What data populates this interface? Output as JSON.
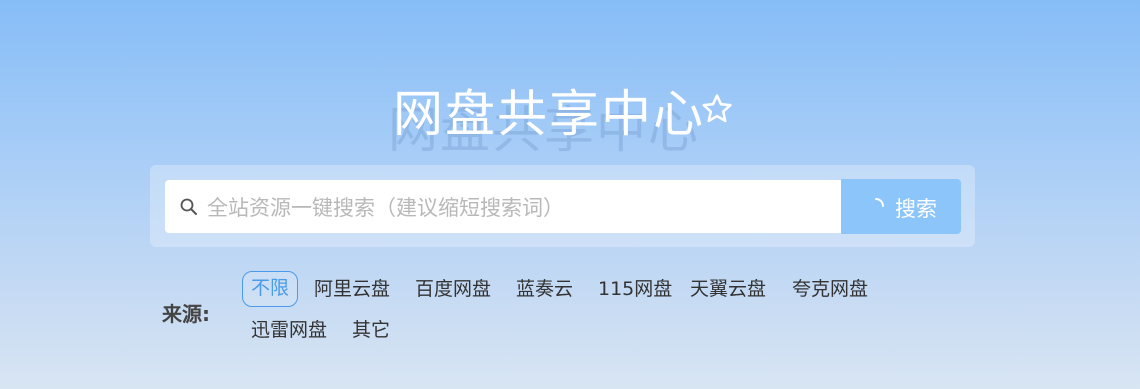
{
  "header": {
    "title": "网盘共享中心",
    "favorite_icon": "star-outline-icon"
  },
  "search": {
    "placeholder": "全站资源一键搜索（建议缩短搜索词）",
    "value": "",
    "button_label": "搜索",
    "search_icon": "magnifier-icon",
    "loading_icon": "spinner-icon"
  },
  "filter": {
    "label": "来源:",
    "options": [
      "不限",
      "阿里云盘",
      "百度网盘",
      "蓝奏云",
      "115网盘",
      "天翼云盘",
      "夸克网盘",
      "迅雷网盘",
      "其它"
    ],
    "selected": "不限"
  },
  "colors": {
    "accent": "#4a9be8",
    "button": "#8cc5f9",
    "background_top": "#86bdf7",
    "background_bottom": "#d8e5f3"
  }
}
